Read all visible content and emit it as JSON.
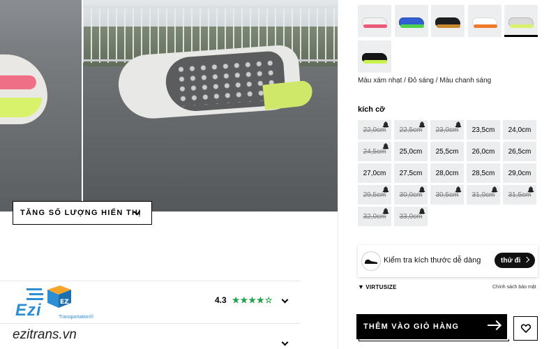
{
  "gallery": {
    "show_more_label": "TĂNG SỐ LƯỢNG HIỂN THỊ"
  },
  "reviews": {
    "rating": "4.3",
    "stars": "★★★★☆"
  },
  "watermark": {
    "brand": "Ezi",
    "tagline": "Transportation®",
    "url": "ezitrans.vn"
  },
  "colors": {
    "thumbnails": [
      {
        "name": "thumb-1",
        "upper": "#f2f2f2",
        "accent": "#e95b78"
      },
      {
        "name": "thumb-2",
        "upper": "#2f5fd0",
        "accent": "#4fd34f"
      },
      {
        "name": "thumb-3",
        "upper": "#1e1e1e",
        "accent": "#c88a2a"
      },
      {
        "name": "thumb-4",
        "upper": "#ffffff",
        "accent": "#f07a2a"
      },
      {
        "name": "thumb-5",
        "upper": "#d9d9d9",
        "accent": "#d8f36b"
      },
      {
        "name": "thumb-6",
        "upper": "#151515",
        "accent": "#c9f24a"
      }
    ],
    "selected_index": 4,
    "selected_name": "Màu xám nhạt / Đỏ sáng / Màu chanh sáng"
  },
  "sizes": {
    "title": "kích cỡ",
    "options": [
      {
        "label": "22,0cm",
        "available": false
      },
      {
        "label": "22,5cm",
        "available": false
      },
      {
        "label": "23,0cm",
        "available": false
      },
      {
        "label": "23,5cm",
        "available": true
      },
      {
        "label": "24,0cm",
        "available": true
      },
      {
        "label": "24,5cm",
        "available": false
      },
      {
        "label": "25,0cm",
        "available": true
      },
      {
        "label": "25,5cm",
        "available": true
      },
      {
        "label": "26,0cm",
        "available": true
      },
      {
        "label": "26,5cm",
        "available": true
      },
      {
        "label": "27,0cm",
        "available": true
      },
      {
        "label": "27,5cm",
        "available": true
      },
      {
        "label": "28,0cm",
        "available": true
      },
      {
        "label": "28,5cm",
        "available": true
      },
      {
        "label": "29,0cm",
        "available": true
      },
      {
        "label": "29,5cm",
        "available": false
      },
      {
        "label": "30,0cm",
        "available": false
      },
      {
        "label": "30,5cm",
        "available": false
      },
      {
        "label": "31,0cm",
        "available": false
      },
      {
        "label": "31,5cm",
        "available": false
      },
      {
        "label": "32,0cm",
        "available": false
      },
      {
        "label": "33,0cm",
        "available": false
      }
    ]
  },
  "fit_check": {
    "text": "Kiểm tra kích thước dễ dàng",
    "button_label": "thử đi"
  },
  "virtusize": {
    "brand": "VIRTUSIZE",
    "privacy": "Chính sách bảo mật"
  },
  "actions": {
    "add_to_cart": "THÊM VÀO GIỎ HÀNG",
    "wishlist_icon": "heart-icon"
  }
}
